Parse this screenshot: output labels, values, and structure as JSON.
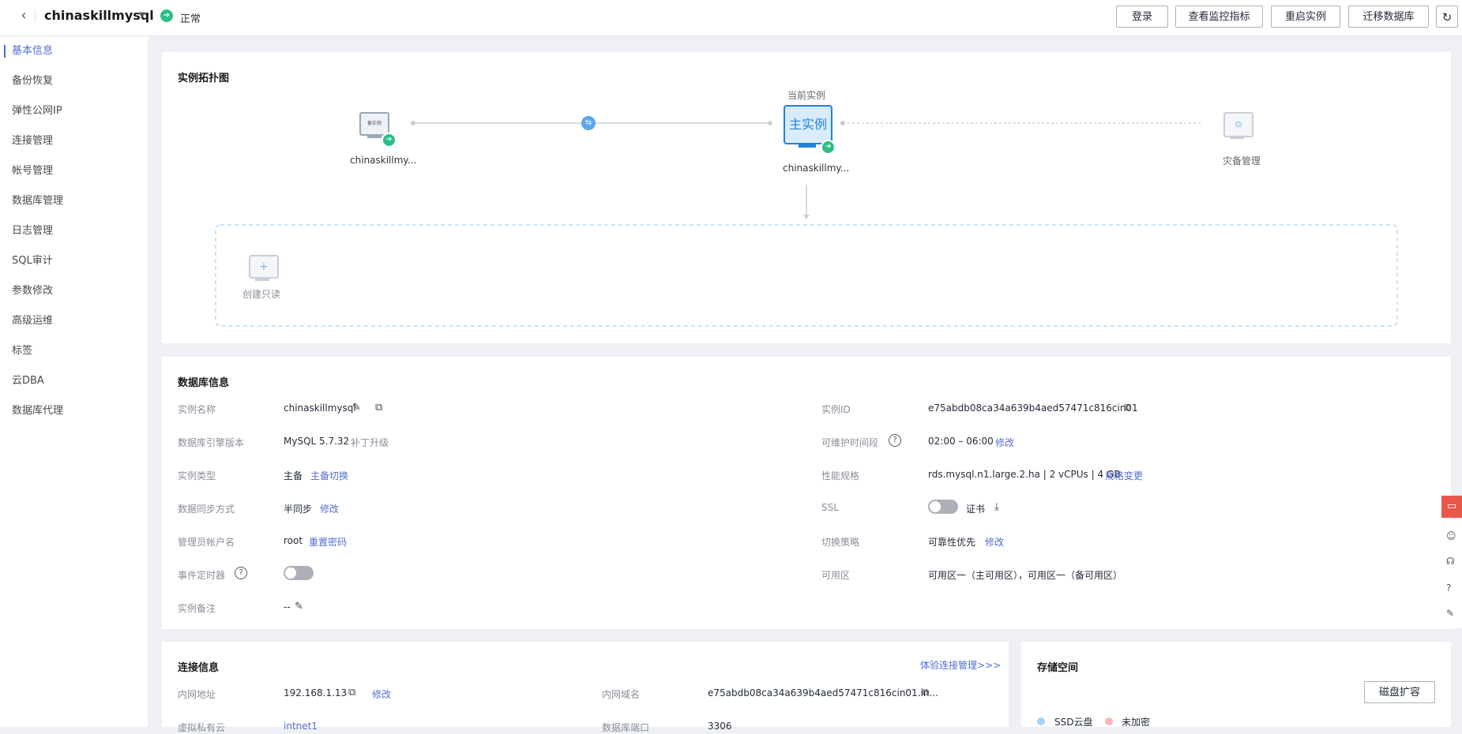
{
  "header": {
    "back_icon": "chevron-left-icon",
    "instance_name": "chinaskillmysql",
    "status": "正常",
    "buttons": [
      "登录",
      "查看监控指标",
      "重启实例",
      "迁移数据库"
    ],
    "refresh_icon": "refresh-icon"
  },
  "sidebar": {
    "items": [
      "基本信息",
      "备份恢复",
      "弹性公网IP",
      "连接管理",
      "帐号管理",
      "数据库管理",
      "日志管理",
      "SQL审计",
      "参数修改",
      "高级运维",
      "标签",
      "云DBA",
      "数据库代理"
    ],
    "active_index": 0
  },
  "topology": {
    "title": "实例拓扑图",
    "current_label": "当前实例",
    "standby_node": {
      "screen_text": "备实例",
      "name": "chinaskillmy..."
    },
    "primary_node": {
      "screen_text": "主实例",
      "name": "chinaskillmy..."
    },
    "dr_node": {
      "name": "灾备管理"
    },
    "create_readonly": "创建只读",
    "colors": {
      "accent": "#4a90e2",
      "status_green": "#2cbe86"
    }
  },
  "db_info": {
    "title": "数据库信息",
    "left": {
      "instance_name_label": "实例名称",
      "instance_name": "chinaskillmysql",
      "engine_label": "数据库引擎版本",
      "engine": "MySQL 5.7.32",
      "engine_action": "补丁升级",
      "type_label": "实例类型",
      "type": "主备",
      "type_action": "主备切换",
      "sync_label": "数据同步方式",
      "sync": "半同步",
      "sync_action": "修改",
      "admin_label": "管理员帐户名",
      "admin": "root",
      "admin_action": "重置密码",
      "event_label": "事件定时器",
      "event_on": false,
      "remark_label": "实例备注",
      "remark": "--"
    },
    "right": {
      "id_label": "实例ID",
      "id": "e75abdb08ca34a639b4aed57471c816cin01",
      "maint_label": "可维护时间段",
      "maint": "02:00 – 06:00",
      "maint_action": "修改",
      "spec_label": "性能规格",
      "spec": "rds.mysql.n1.large.2.ha | 2 vCPUs | 4 GB",
      "spec_action": "规格变更",
      "ssl_label": "SSL",
      "ssl_on": false,
      "ssl_cert": "证书",
      "switch_label": "切换策略",
      "switch": "可靠性优先",
      "switch_action": "修改",
      "az_label": "可用区",
      "az": "可用区一（主可用区），可用区一（备可用区）"
    }
  },
  "conn_info": {
    "title": "连接信息",
    "experience_link": "体验连接管理>>>",
    "private_ip_label": "内网地址",
    "private_ip": "192.168.1.13",
    "private_ip_action": "修改",
    "private_domain_label": "内网域名",
    "private_domain": "e75abdb08ca34a639b4aed57471c816cin01.in...",
    "vpc_label": "虚拟私有云",
    "vpc": "intnet1",
    "port_label": "数据库端口",
    "port": "3306"
  },
  "storage": {
    "title": "存储空间",
    "expand_button": "磁盘扩容",
    "legend_ssd": "SSD云盘",
    "legend_unencrypted": "未加密"
  }
}
